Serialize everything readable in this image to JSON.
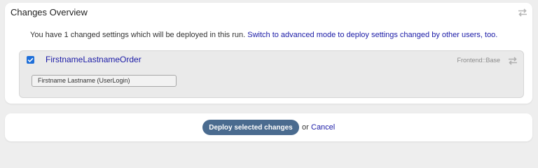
{
  "panel": {
    "title": "Changes Overview",
    "switch_icon": "swap-arrows-icon"
  },
  "info": {
    "text": "You have 1 changed settings which will be deployed in this run.",
    "advanced_link": "Switch to advanced mode to deploy settings changed by other users, too."
  },
  "setting": {
    "checked": true,
    "name": "FirstnameLastnameOrder",
    "scope": "Frontend::Base",
    "value": "Firstname Lastname (UserLogin)"
  },
  "actions": {
    "deploy_label": "Deploy selected changes",
    "or_text": "or",
    "cancel_label": "Cancel"
  },
  "colors": {
    "background": "#eeeeee",
    "panel": "#ffffff",
    "link": "#1a1aa6",
    "deploy_button": "#4a6b8f",
    "checkbox": "#1e6fd9"
  }
}
